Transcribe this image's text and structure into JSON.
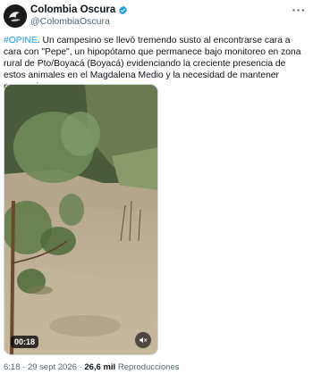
{
  "author": {
    "display_name": "Colombia Oscura",
    "handle": "@ColombiaOscura",
    "avatar_icon": "avatar-logo",
    "verified_color": "#1d9bf0"
  },
  "tweet": {
    "hashtag": "#OPINE",
    "body": ". Un campesino se llevó tremendo susto al encontrarse cara a cara con \"Pepe\", un hipopótamo que permanece bajo monitoreo en zona rural de Pto/Boyacá (Boyacá) evidenciando la creciente presencia de estos animales en el Magdalena Medio y la necesidad de mantener precauciones."
  },
  "media": {
    "duration": "00:18",
    "mute_icon": "muted-speaker-icon"
  },
  "meta": {
    "time": "6:18",
    "separator1": " · ",
    "date": "29 sept 2026",
    "separator2": " · ",
    "views": "26,6 mil",
    "views_label": " Reproducciones"
  },
  "colors": {
    "accent": "#1d9bf0",
    "secondary_text": "#536471"
  }
}
